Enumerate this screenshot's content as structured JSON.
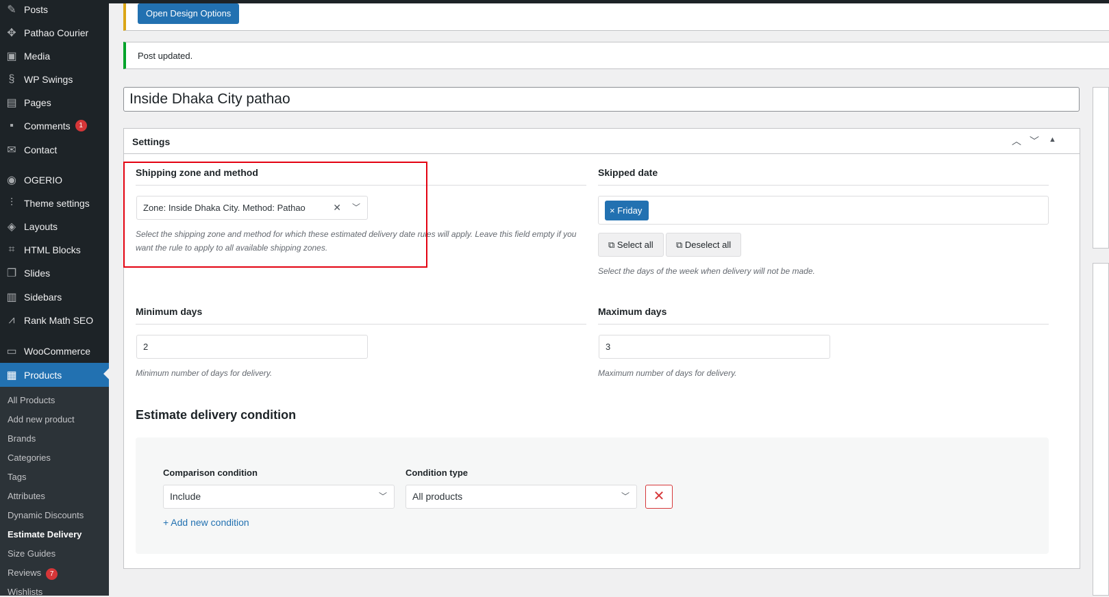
{
  "sidebar": {
    "items": [
      {
        "label": "Posts",
        "icon": "pin-icon"
      },
      {
        "label": "Pathao Courier",
        "icon": "move-icon"
      },
      {
        "label": "Media",
        "icon": "media-icon"
      },
      {
        "label": "WP Swings",
        "icon": "swings-icon"
      },
      {
        "label": "Pages",
        "icon": "pages-icon"
      },
      {
        "label": "Comments",
        "icon": "comment-icon",
        "badge": "1"
      },
      {
        "label": "Contact",
        "icon": "mail-icon"
      },
      {
        "label": "OGERIO",
        "icon": "ogerio-icon"
      },
      {
        "label": "Theme settings",
        "icon": "sliders-icon"
      },
      {
        "label": "Layouts",
        "icon": "layers-icon"
      },
      {
        "label": "HTML Blocks",
        "icon": "code-icon"
      },
      {
        "label": "Slides",
        "icon": "slides-icon"
      },
      {
        "label": "Sidebars",
        "icon": "sidebar-icon"
      },
      {
        "label": "Rank Math SEO",
        "icon": "chart-icon"
      },
      {
        "label": "WooCommerce",
        "icon": "woo-icon"
      },
      {
        "label": "Products",
        "icon": "archive-icon"
      }
    ],
    "submenu": [
      {
        "label": "All Products"
      },
      {
        "label": "Add new product"
      },
      {
        "label": "Brands"
      },
      {
        "label": "Categories"
      },
      {
        "label": "Tags"
      },
      {
        "label": "Attributes"
      },
      {
        "label": "Dynamic Discounts"
      },
      {
        "label": "Estimate Delivery"
      },
      {
        "label": "Size Guides"
      },
      {
        "label": "Reviews",
        "badge": "7"
      },
      {
        "label": "Wishlists"
      }
    ]
  },
  "notice": {
    "design_button": "Open Design Options",
    "updated": "Post updated."
  },
  "post_title": "Inside Dhaka City pathao",
  "settings": {
    "title": "Settings",
    "shipping": {
      "label": "Shipping zone and method",
      "value": "Zone: Inside Dhaka City. Method: Pathao",
      "desc": "Select the shipping zone and method for which these estimated delivery date rules will apply. Leave this field empty if you want the rule to apply to all available shipping zones."
    },
    "skipped": {
      "label": "Skipped date",
      "tag": "Friday",
      "select_all": "Select all",
      "deselect_all": "Deselect all",
      "desc": "Select the days of the week when delivery will not be made."
    },
    "min_days": {
      "label": "Minimum days",
      "value": "2",
      "desc": "Minimum number of days for delivery."
    },
    "max_days": {
      "label": "Maximum days",
      "value": "3",
      "desc": "Maximum number of days for delivery."
    },
    "condition": {
      "title": "Estimate delivery condition",
      "comparison_label": "Comparison condition",
      "comparison_value": "Include",
      "type_label": "Condition type",
      "type_value": "All products",
      "add_label": "Add new condition"
    }
  },
  "colors": {
    "accent": "#2271b1",
    "sidebar": "#1d2327",
    "highlight": "#e3000f"
  }
}
